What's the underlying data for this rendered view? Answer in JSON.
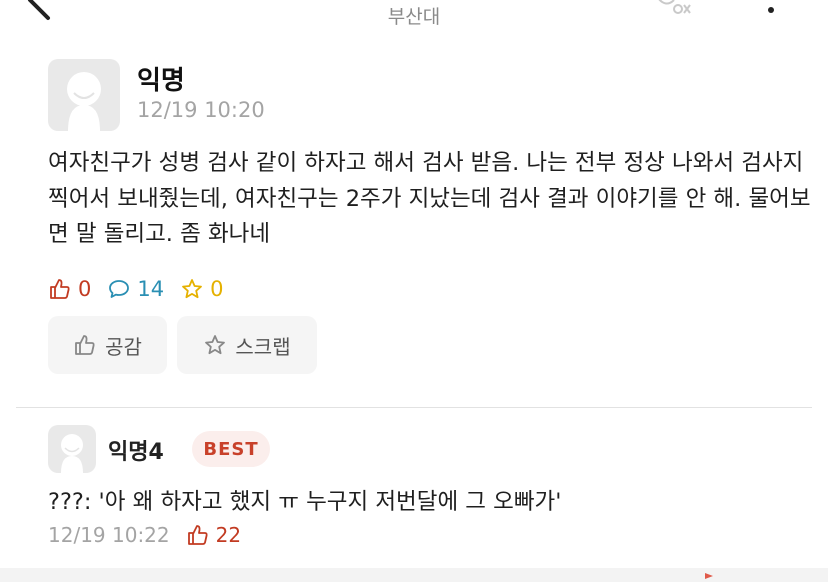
{
  "header": {
    "title": "부산대"
  },
  "post": {
    "author": "익명",
    "time": "12/19 10:20",
    "content": "여자친구가 성병 검사 같이 하자고 해서 검사 받음. 나는 전부 정상 나와서 검사지 찍어서 보내줬는데, 여자친구는 2주가 지났는데 검사 결과 이야기를 안 해. 물어보면 말 돌리고. 좀 화나네",
    "counts": {
      "likes": "0",
      "comments": "14",
      "scraps": "0"
    },
    "buttons": {
      "like_label": "공감",
      "scrap_label": "스크랩"
    }
  },
  "comment": {
    "author": "익명4",
    "badge": "BEST",
    "content": "???: '아 왜 하자고 했지 ㅠ 누구지 저번달에 그 오빠가'",
    "time": "12/19 10:22",
    "likes": "22"
  },
  "colors": {
    "like_red": "#c23b22",
    "comment_blue": "#2a8fb3",
    "scrap_yellow": "#e5b100",
    "best_bg": "#fbeeec",
    "muted_gray": "#a4a4a4"
  },
  "icons": [
    "back-arrow-icon",
    "notification-icon",
    "more-menu-icon",
    "thumbs-up-icon",
    "comment-bubble-icon",
    "star-icon",
    "avatar-icon"
  ]
}
